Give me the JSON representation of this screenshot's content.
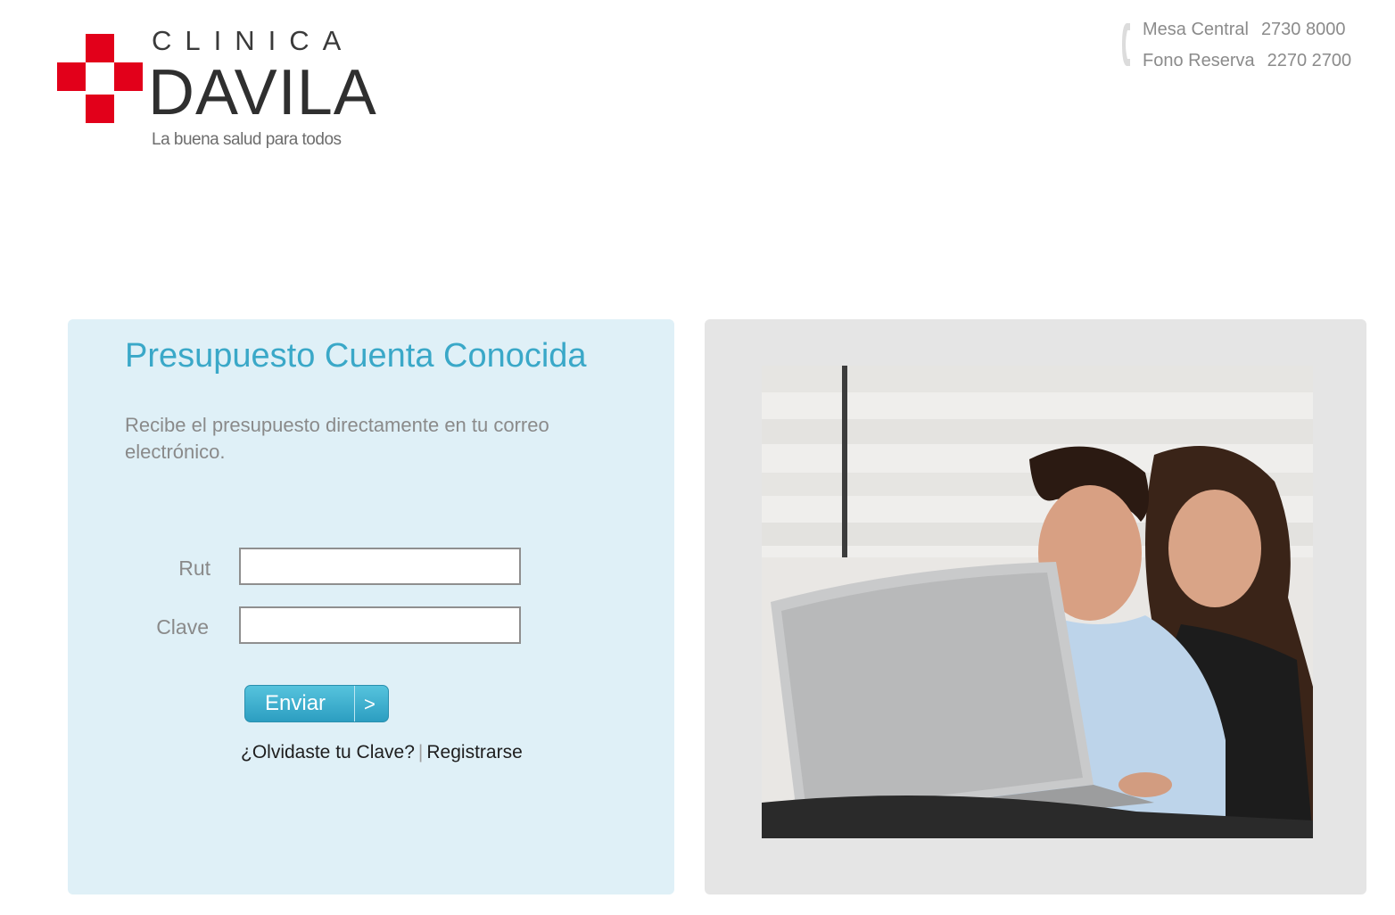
{
  "logo": {
    "word1": "CLINICA",
    "word2": "DAVILA",
    "tagline": "La buena salud para todos"
  },
  "phones": [
    {
      "label": "Mesa Central",
      "number": "2730 8000"
    },
    {
      "label": "Fono Reserva",
      "number": "2270 2700"
    }
  ],
  "form": {
    "title": "Presupuesto Cuenta Conocida",
    "subtitle": "Recibe el presupuesto directamente en tu correo electrónico.",
    "rut_label": "Rut",
    "rut_value": "",
    "clave_label": "Clave",
    "clave_value": "",
    "submit_label": "Enviar",
    "submit_arrow": ">",
    "forgot_label": "¿Olvidaste tu Clave?",
    "separator": "|",
    "register_label": "Registrarse"
  },
  "colors": {
    "brand_red": "#e2001a",
    "accent_blue": "#3aa8c8",
    "form_bg": "#dff0f7",
    "photo_panel_bg": "#e5e5e5"
  },
  "icons": [
    "phone-icon",
    "clinic-cross-logo"
  ]
}
